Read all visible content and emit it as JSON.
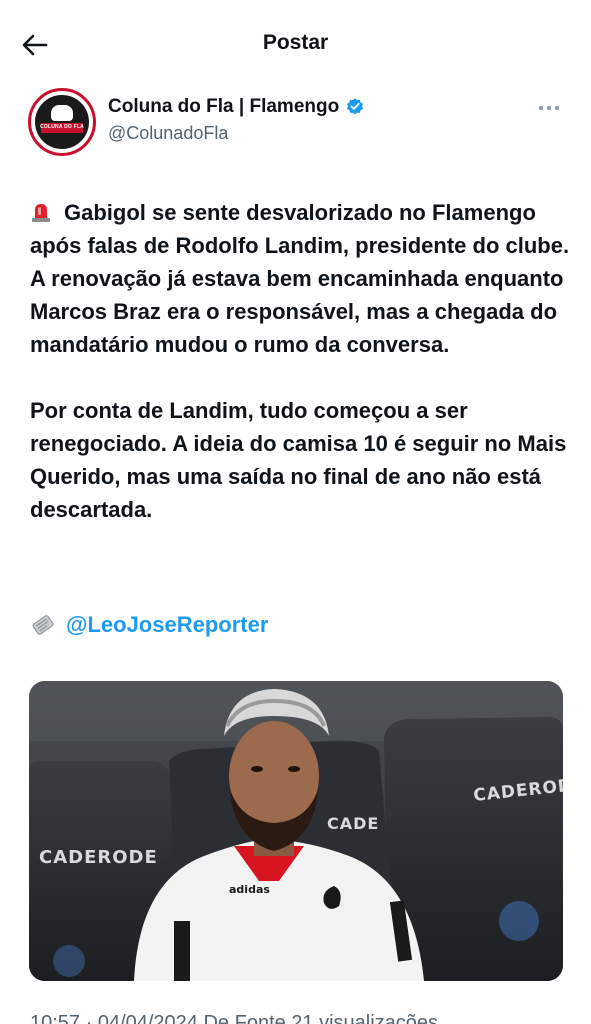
{
  "header": {
    "title": "Postar",
    "back_icon": "arrow-left-icon"
  },
  "author": {
    "display_name": "Coluna do Fla | Flamengo",
    "handle": "@ColunadoFla",
    "verified": true,
    "avatar_text": "COLUNA DO FLA",
    "accent_color": "#c8102e",
    "verified_color": "#1d9bf0"
  },
  "tweet": {
    "siren_icon": "police-siren-emoji",
    "paragraph_1": "Gabigol se sente desvalorizado no Flamengo após falas de Rodolfo Landim, presidente do clube. A renovação já estava bem encaminhada enquanto Marcos Braz era o responsável, mas a chegada do mandatário mudou o rumo da conversa.",
    "paragraph_2": "Por conta de Landim, tudo começou a ser renegociado. A ideia do camisa 10 é seguir no Mais Querido, mas uma saída no final de ano não está descartada.",
    "credit_icon": "newspaper-emoji",
    "credit_mention": "@LeoJoseReporter",
    "mention_color": "#1d9bf0"
  },
  "media": {
    "description_icon": "photo",
    "sponsor_text_left": "CADERODE",
    "sponsor_text_right": "CADERODE",
    "sponsor_text_middle": "CADE"
  },
  "meta": {
    "partial_line": "10:57 · 04/04/2024 De Fonte 21 visualizações"
  }
}
